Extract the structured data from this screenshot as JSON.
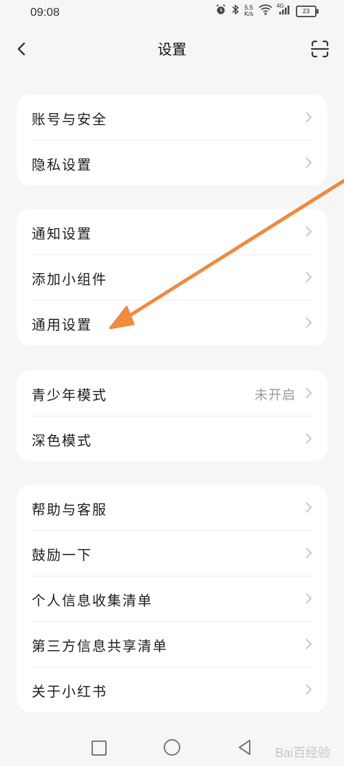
{
  "status_bar": {
    "time": "09:08",
    "speed_value": "5.5",
    "speed_unit": "K/s",
    "network": "4G",
    "battery": "23"
  },
  "header": {
    "title": "设置",
    "back_icon": "chevron-left-icon",
    "scan_icon": "scan-icon"
  },
  "sections": [
    {
      "items": [
        {
          "label": "账号与安全"
        },
        {
          "label": "隐私设置"
        }
      ]
    },
    {
      "items": [
        {
          "label": "通知设置"
        },
        {
          "label": "添加小组件"
        },
        {
          "label": "通用设置"
        }
      ]
    },
    {
      "items": [
        {
          "label": "青少年模式",
          "value": "未开启"
        },
        {
          "label": "深色模式"
        }
      ]
    },
    {
      "items": [
        {
          "label": "帮助与客服"
        },
        {
          "label": "鼓励一下"
        },
        {
          "label": "个人信息收集清单"
        },
        {
          "label": "第三方信息共享清单"
        },
        {
          "label": "关于小红书"
        }
      ]
    }
  ],
  "bottom_nav": {
    "recents_icon": "square-icon",
    "home_icon": "circle-icon",
    "back_icon": "triangle-back-icon"
  },
  "watermark": "Bai百经验",
  "colors": {
    "background": "#f6f6f6",
    "card": "#ffffff",
    "annotation_arrow": "#f08a3c"
  }
}
